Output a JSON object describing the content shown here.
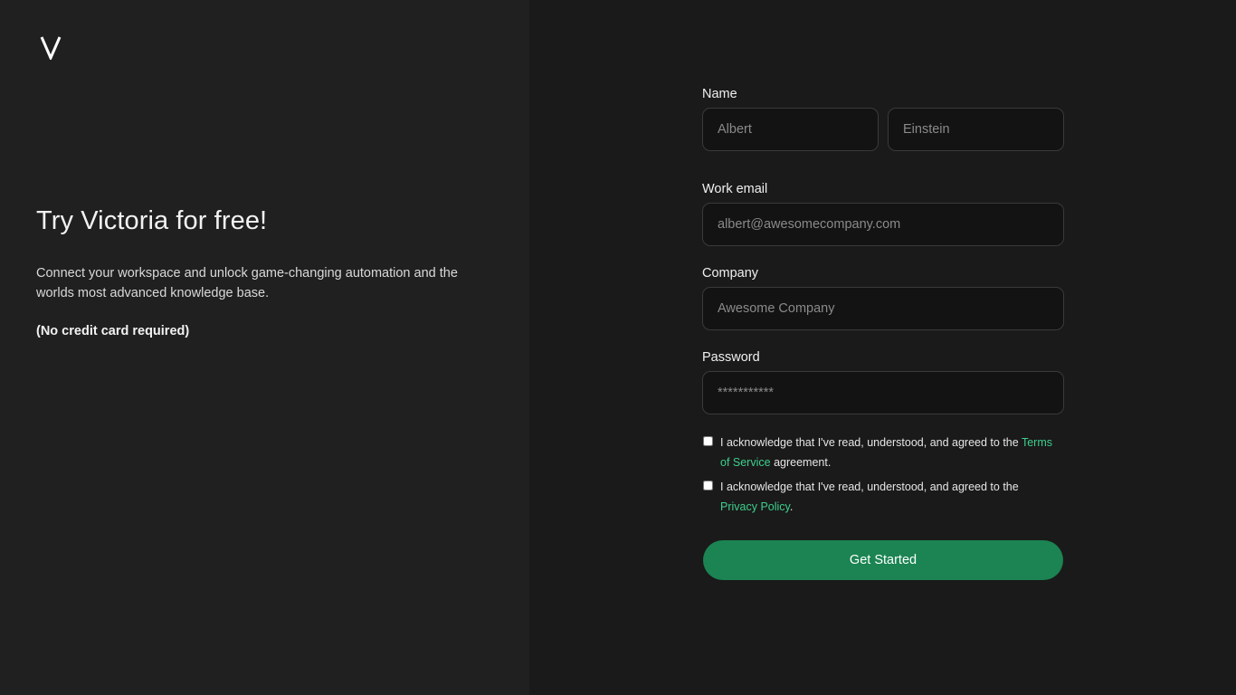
{
  "brand": {
    "logo_icon": "victoria-v-logo-icon"
  },
  "hero": {
    "headline": "Try Victoria for free!",
    "description": "Connect your workspace and unlock game-changing automation and the worlds most advanced knowledge base.",
    "note": "(No credit card required)"
  },
  "form": {
    "name_label": "Name",
    "first_name_placeholder": "Albert",
    "last_name_placeholder": "Einstein",
    "email_label": "Work email",
    "email_placeholder": "albert@awesomecompany.com",
    "company_label": "Company",
    "company_placeholder": "Awesome Company",
    "password_label": "Password",
    "password_placeholder": "***********",
    "terms_checked": false,
    "terms_prefix": "I acknowledge that I've read, understood, and agreed to the ",
    "terms_link": "Terms of Service",
    "terms_suffix": " agreement.",
    "privacy_checked": false,
    "privacy_prefix": "I acknowledge that I've read, understood, and agreed to the ",
    "privacy_link": "Privacy Policy",
    "privacy_suffix": ".",
    "submit_label": "Get Started"
  },
  "colors": {
    "accent": "#1b8452",
    "link": "#3ecf8e",
    "left_panel": "#202020",
    "right_panel": "#1a1a1a"
  }
}
